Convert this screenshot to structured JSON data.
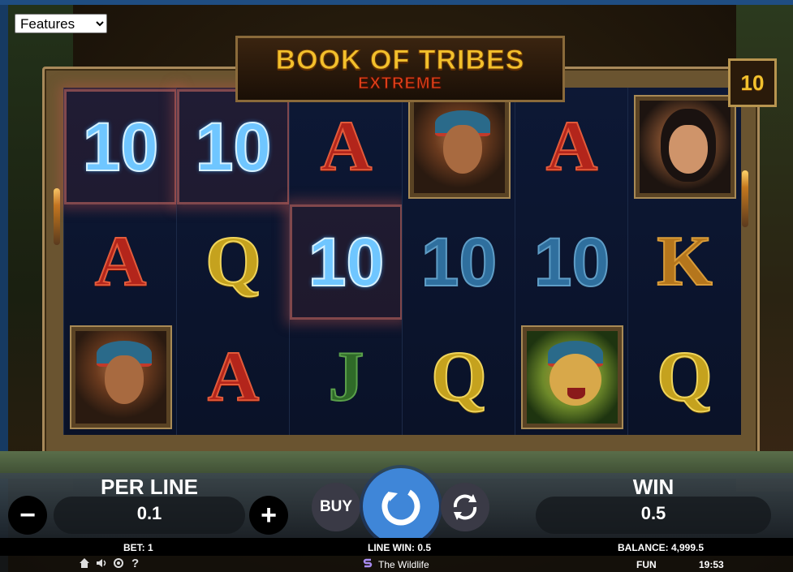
{
  "features_select": {
    "value": "Features"
  },
  "title": {
    "main": "BOOK OF TRIBES",
    "sub": "EXTREME"
  },
  "free_spins_counter": "10",
  "reels": [
    [
      "10",
      "A",
      "man"
    ],
    [
      "10",
      "Q",
      "A"
    ],
    [
      "A",
      "10",
      "J"
    ],
    [
      "man",
      "10",
      "Q"
    ],
    [
      "A",
      "10",
      "jaguar"
    ],
    [
      "woman",
      "K",
      "Q"
    ]
  ],
  "controls": {
    "per_line_label": "PER LINE",
    "per_line_value": "0.1",
    "minus": "−",
    "plus": "+",
    "buy": "BUY",
    "win_label": "WIN",
    "win_value": "0.5"
  },
  "info_bar": {
    "bet": "BET: 1",
    "line_win": "LINE WIN: 0.5",
    "balance": "BALANCE: 4,999.5"
  },
  "bottom_bar": {
    "brand": "The Wildlife",
    "mode": "FUN",
    "time": "19:53",
    "help": "?"
  },
  "colors": {
    "spin_button": "#3f86d8",
    "accent_gold": "#f3c02c"
  }
}
